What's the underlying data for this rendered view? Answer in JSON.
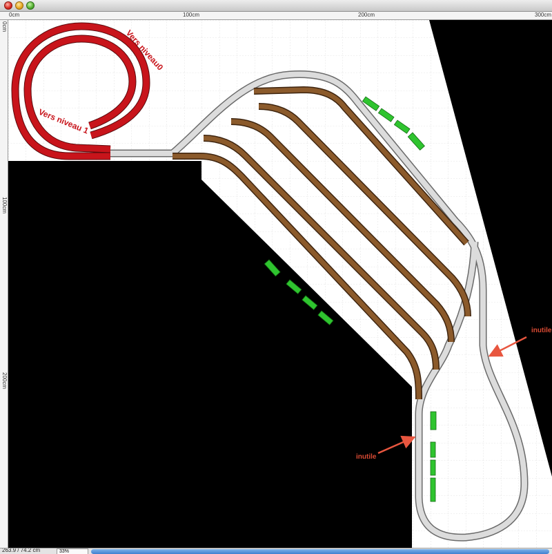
{
  "window": {
    "controls": [
      "close",
      "minimize",
      "zoom"
    ]
  },
  "ruler": {
    "top_labels": [
      "0cm",
      "100cm",
      "200cm",
      "300cm"
    ],
    "left_labels": [
      "0cm",
      "100cm",
      "200cm"
    ]
  },
  "canvas": {
    "annotations": {
      "loop_label_1": "Vers niveau0",
      "loop_label_2": "Vers niveau 1",
      "note_right": "inutile",
      "note_left": "inutile"
    },
    "colors": {
      "background": "#ffffff",
      "grid": "#cccccc",
      "blocked_area": "#000000",
      "helix_track": "#c8141b",
      "siding_track": "#8b5a2b",
      "main_track": "#d4d4d4",
      "rolling_stock": "#2fc42f",
      "arrow": "#e8563f"
    }
  },
  "status": {
    "coordinates": "263.9 / 74.2 cm",
    "zoom": "33%"
  }
}
